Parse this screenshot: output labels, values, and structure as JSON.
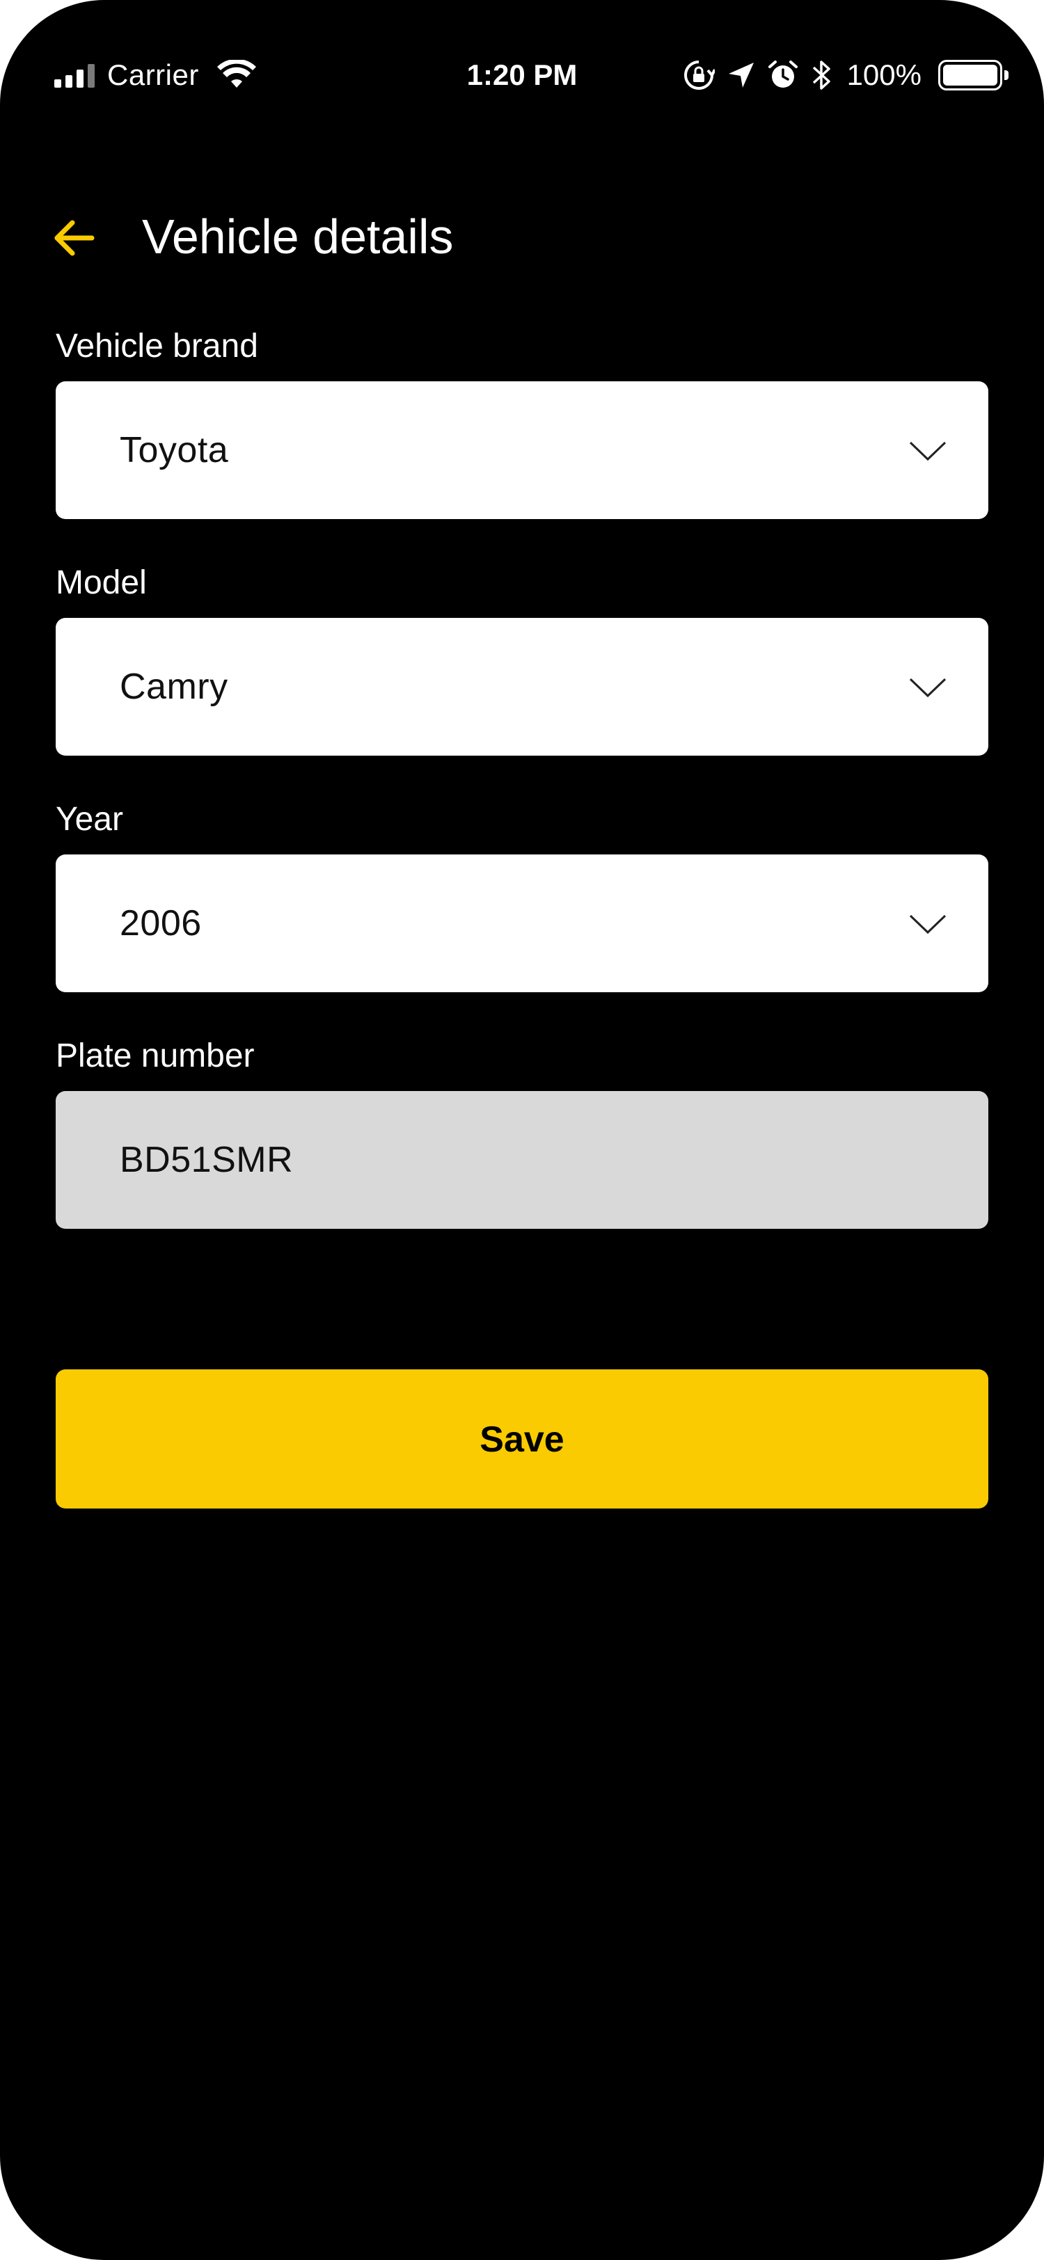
{
  "status_bar": {
    "carrier": "Carrier",
    "time": "1:20 PM",
    "battery_percent": "100%",
    "battery_level": 1.0,
    "signal_bars_filled": 3,
    "signal_bars_total": 4,
    "icons": [
      "signal-icon",
      "wifi-icon",
      "rotation-lock-icon",
      "location-icon",
      "alarm-icon",
      "bluetooth-icon",
      "battery-icon"
    ]
  },
  "header": {
    "title": "Vehicle details",
    "back_icon": "arrow-left-icon"
  },
  "form": {
    "brand": {
      "label": "Vehicle brand",
      "value": "Toyota"
    },
    "model": {
      "label": "Model",
      "value": "Camry"
    },
    "year": {
      "label": "Year",
      "value": "2006"
    },
    "plate": {
      "label": "Plate number",
      "value": "BD51SMR"
    }
  },
  "actions": {
    "save_label": "Save"
  },
  "colors": {
    "background": "#000000",
    "accent": "#f9cb00",
    "field_background": "#ffffff",
    "disabled_field_background": "#d9d9d9",
    "text_light": "#ffffff",
    "text_dark": "#111111"
  }
}
